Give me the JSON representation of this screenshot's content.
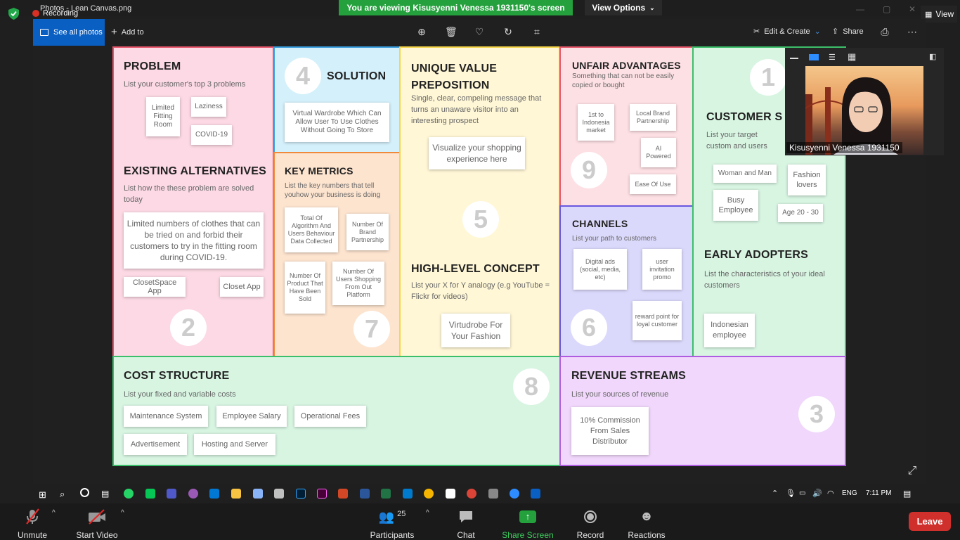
{
  "zoom": {
    "recording_label": "Recording",
    "window_title": "Photos - Lean Canvas.png",
    "viewing_banner": "You are viewing Kisusyenni Venessa 1931150's screen",
    "view_options": "View Options",
    "view_button": "View",
    "participant_name": "Kisusyenni Venessa 1931150",
    "participants_count": "25",
    "buttons": {
      "unmute": "Unmute",
      "start_video": "Start Video",
      "participants": "Participants",
      "chat": "Chat",
      "share_screen": "Share Screen",
      "record": "Record",
      "reactions": "Reactions",
      "leave": "Leave"
    },
    "colors": {
      "banner": "#24a03d",
      "share": "#24a03d",
      "leave": "#d0302c",
      "recording": "#d93025"
    }
  },
  "photos": {
    "see_all": "See all photos",
    "add_to": "Add to",
    "edit_create": "Edit & Create",
    "share": "Share"
  },
  "canvas": {
    "problem": {
      "title": "PROBLEM",
      "subtitle": "List your customer's top 3 problems",
      "notes": [
        "Limited Fitting Room",
        "Laziness",
        "COVID-19"
      ]
    },
    "existing_alternatives": {
      "title": "EXISTING ALTERNATIVES",
      "subtitle": "List how the these problem are solved today",
      "notes": [
        "Limited numbers of clothes that can be tried on and forbid their customers to try in the fitting room during COVID-19.",
        "ClosetSpace App",
        "Closet App"
      ],
      "number": "2"
    },
    "solution": {
      "title": "SOLUTION",
      "number": "4",
      "notes": [
        "Virtual Wardrobe Which Can Allow User To Use Clothes Without Going To Store"
      ]
    },
    "key_metrics": {
      "title": "KEY METRICS",
      "subtitle": "List the key numbers that tell youhow your business is doing",
      "notes": [
        "Total Of Algorithm And Users Behaviour Data Collected",
        "Number Of Brand Partnership",
        "Number Of Product That Have Been Sold",
        "Number Of Users Shopping From Out Platform"
      ],
      "number": "7"
    },
    "uvp": {
      "title": "UNIQUE VALUE PREPOSITION",
      "subtitle": "Single, clear, compeling message that turns an unaware visitor into an interesting prospect",
      "notes": [
        "Visualize your shopping experience here"
      ],
      "number": "5"
    },
    "high_level": {
      "title": "HIGH-LEVEL CONCEPT",
      "subtitle": "List your X for Y analogy (e.g YouTube = Flickr for videos)",
      "notes": [
        "Virtudrobe For Your Fashion"
      ]
    },
    "unfair": {
      "title": "UNFAIR ADVANTAGES",
      "subtitle": "Something that can not be easily copied or bought",
      "notes": [
        "1st to Indonesia market",
        "Local Brand Partnership",
        "AI Powered",
        "Ease Of Use"
      ],
      "number": "9"
    },
    "channels": {
      "title": "CHANNELS",
      "subtitle": "List your path to customers",
      "notes": [
        "Digital ads (social, media, etc)",
        "user invitation promo",
        "reward point for loyal customer"
      ],
      "number": "6"
    },
    "customer_segments": {
      "title": "CUSTOMER S",
      "subtitle": "List your target custom and users",
      "notes": [
        "Woman and Man",
        "Fashion lovers",
        "Busy Employee",
        "Age 20 - 30"
      ],
      "number": "1"
    },
    "early_adopters": {
      "title": "EARLY ADOPTERS",
      "subtitle": "List the characteristics of your ideal customers",
      "notes": [
        "Indonesian employee"
      ]
    },
    "cost_structure": {
      "title": "COST STRUCTURE",
      "subtitle": "List your fixed and variable costs",
      "notes": [
        "Maintenance System",
        "Employee Salary",
        "Operational Fees",
        "Advertisement",
        "Hosting and Server"
      ],
      "number": "8"
    },
    "revenue": {
      "title": "REVENUE STREAMS",
      "subtitle": "List your sources of revenue",
      "notes": [
        "10% Commission From Sales Distributor"
      ],
      "number": "3"
    }
  },
  "taskbar": {
    "language": "ENG",
    "time": "7:11 PM"
  }
}
